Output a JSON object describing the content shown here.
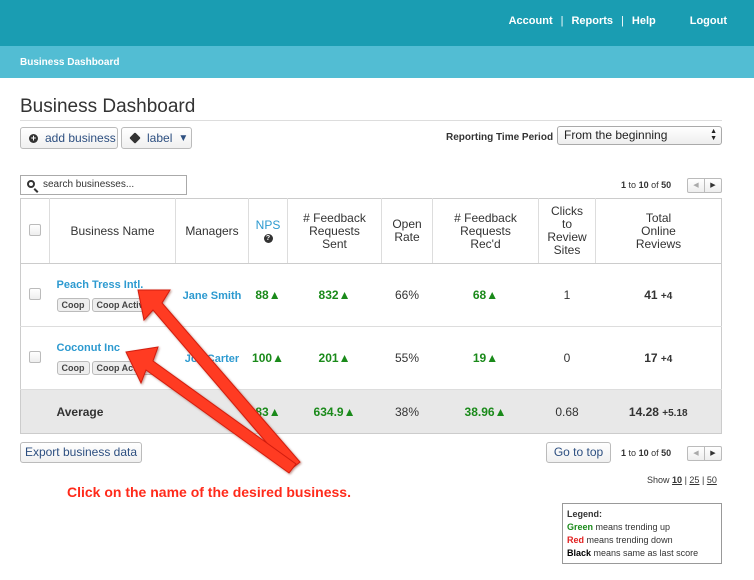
{
  "topnav": {
    "account": "Account",
    "sep": "|",
    "reports": "Reports",
    "help": "Help",
    "logout": "Logout"
  },
  "subbar": {
    "title": "Business Dashboard"
  },
  "page": {
    "title": "Business Dashboard"
  },
  "toolbar": {
    "add_business": "add business",
    "label": "label",
    "label_caret": "▼"
  },
  "period": {
    "label": "Reporting Time Period",
    "selected": "From the beginning"
  },
  "search": {
    "placeholder": "search businesses..."
  },
  "pager": {
    "from": "1",
    "to_word": "to",
    "to": "10",
    "of_word": "of",
    "total": "50",
    "prev": "◀",
    "next": "▶"
  },
  "table": {
    "headers": {
      "business_name": "Business Name",
      "managers": "Managers",
      "nps": "NPS",
      "nps_help": "?",
      "feedback_sent": [
        "# Feedback",
        "Requests",
        "Sent"
      ],
      "open_rate": [
        "Open",
        "Rate"
      ],
      "feedback_recd": [
        "# Feedback",
        "Requests",
        "Rec'd"
      ],
      "clicks": [
        "Clicks",
        "to",
        "Review",
        "Sites"
      ],
      "total_reviews": [
        "Total",
        "Online",
        "Reviews"
      ]
    },
    "rows": [
      {
        "name": "Peach Tress Intl.",
        "badges": [
          "Coop",
          "Coop Active"
        ],
        "manager": "Jane Smith",
        "nps": "88▲",
        "sent": "832▲",
        "open_rate": "66%",
        "recd": "68▲",
        "clicks": "1",
        "total": "41",
        "total_delta": "+4"
      },
      {
        "name": "Coconut Inc",
        "badges": [
          "Coop",
          "Coop Active"
        ],
        "manager": "Joe Carter",
        "nps": "100▲",
        "sent": "201▲",
        "open_rate": "55%",
        "recd": "19▲",
        "clicks": "0",
        "total": "17",
        "total_delta": "+4"
      }
    ],
    "average": {
      "label": "Average",
      "nps": "83▲",
      "sent": "634.9▲",
      "open_rate": "38%",
      "recd": "38.96▲",
      "clicks": "0.68",
      "total": "14.28",
      "total_delta": "+5.18"
    }
  },
  "footer": {
    "export": "Export business data",
    "go_top": "Go to top",
    "show_word": "Show",
    "show_10": "10",
    "show_25": "25",
    "show_50": "50",
    "bar": "|"
  },
  "callout": {
    "text": "Click on the name of the desired business."
  },
  "legend": {
    "title": "Legend:",
    "green_word": "Green",
    "green_text": " means trending up",
    "red_word": "Red",
    "red_text": " means trending down",
    "black_word": "Black",
    "black_text": " means same as last score"
  },
  "colors": {
    "topbar": "#1a9db2",
    "subbar": "#52bdd3",
    "link": "#2d9ad0",
    "up": "#1a8a1a",
    "annotation": "#ff2a1a"
  }
}
